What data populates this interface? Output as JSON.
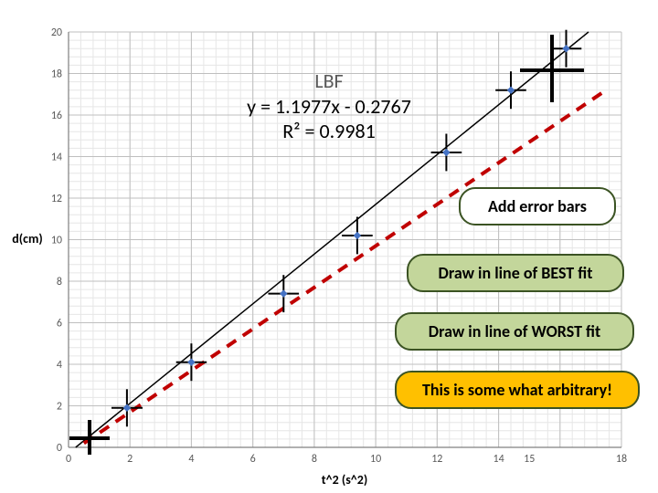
{
  "chart_data": {
    "type": "scatter",
    "xlabel": "t^2 (s^2)",
    "ylabel": "d(cm)",
    "xlim": [
      0,
      18
    ],
    "ylim": [
      0,
      20
    ],
    "x_ticks": [
      0,
      2,
      4,
      6,
      8,
      10,
      12,
      14,
      15,
      18
    ],
    "y_ticks": [
      0,
      2,
      4,
      6,
      8,
      10,
      12,
      14,
      16,
      18,
      20
    ],
    "series": [
      {
        "name": "data points",
        "type": "scatter",
        "x": [
          1.9,
          4,
          7,
          9.4,
          12.3,
          14.4,
          16.2
        ],
        "y": [
          1.9,
          4.1,
          7.4,
          10.2,
          14.2,
          17.2,
          19.2
        ]
      },
      {
        "name": "LBF",
        "type": "line",
        "equation": "y = 1.1977x - 0.2767",
        "x": [
          0,
          17.5
        ],
        "y": [
          -0.2767,
          20.683
        ]
      },
      {
        "name": "WORST fit",
        "type": "line",
        "style": "dashed",
        "color": "#c00000",
        "x": [
          0.5,
          17.5
        ],
        "y": [
          0.2,
          17.2
        ]
      }
    ],
    "error_bars": {
      "dx": 0.5,
      "dy": 0.9
    },
    "trend": {
      "label": "LBF",
      "equation": "y = 1.1977x - 0.2767",
      "r_squared": 0.9981
    }
  },
  "equation_block": {
    "title": "LBF",
    "line1": "y = 1.1977x - 0.2767",
    "line2": "R² = 0.9981"
  },
  "callouts": {
    "error_bars": "Add error bars",
    "best_fit": "Draw in line of BEST fit",
    "worst_fit": "Draw in line of WORST fit",
    "note": "This is some what arbitrary!"
  }
}
